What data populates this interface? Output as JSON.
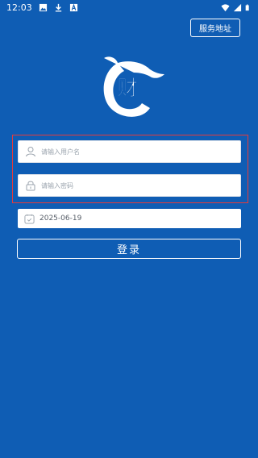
{
  "status_bar": {
    "time": "12:03",
    "left_icons": [
      "image-icon",
      "download-icon",
      "a-box-icon"
    ],
    "right_icons": [
      "wifi-icon",
      "signal-icon",
      "battery-icon"
    ]
  },
  "header": {
    "service_button_label": "服务地址"
  },
  "logo": {
    "glyph": "财"
  },
  "form": {
    "username_placeholder": "请输入用户名",
    "password_placeholder": "请输入密码",
    "date_value": "2025-06-19",
    "login_label": "登录"
  },
  "colors": {
    "background": "#0f5db4",
    "highlight_border": "#e53b3b",
    "field_background": "#ffffff"
  }
}
